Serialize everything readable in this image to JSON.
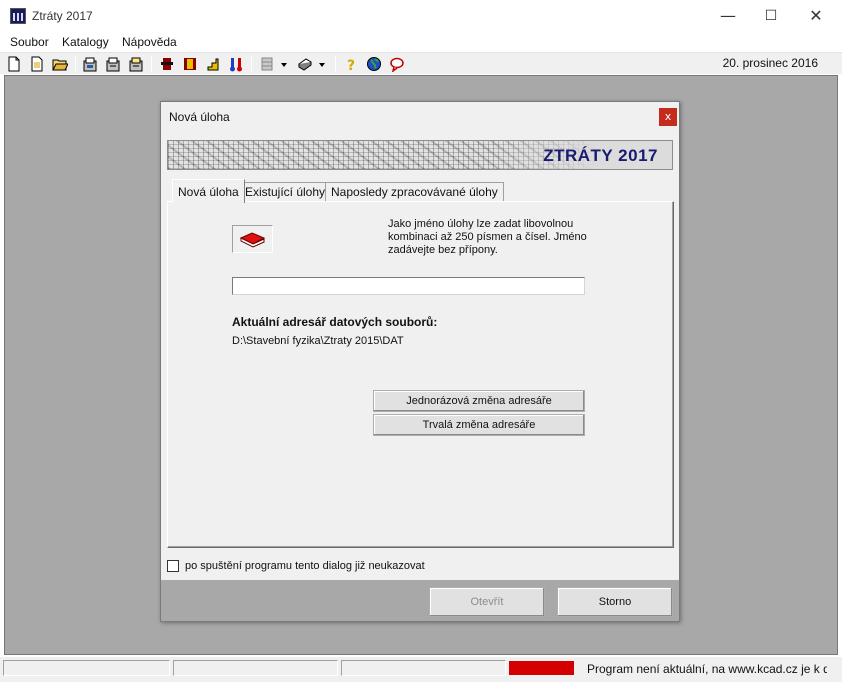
{
  "window": {
    "title": "Ztráty 2017",
    "controls": {
      "minimize": "—",
      "maximize": "☐",
      "close": "✕"
    }
  },
  "menu": {
    "items": [
      "Soubor",
      "Katalogy",
      "Nápověda"
    ]
  },
  "toolbar": {
    "icons": [
      "new-icon",
      "open-icon",
      "open-folder-icon",
      "catalog-icon",
      "catalog-edit-icon",
      "catalog-export-icon",
      "wall-icon",
      "window-icon",
      "stairs-icon",
      "thermometer-icon",
      "layers-icon",
      "print-icon",
      "help-icon",
      "globe-icon",
      "chat-icon"
    ],
    "date": "20. prosinec 2016"
  },
  "dialog": {
    "title": "Nová úloha",
    "close_label": "x",
    "banner_text": "ZTRÁTY 2017",
    "tabs": [
      {
        "label": "Nová úloha",
        "active": true
      },
      {
        "label": "Existující úlohy",
        "active": false
      },
      {
        "label": "Naposledy zpracovávané úlohy",
        "active": false
      }
    ],
    "help_text": "Jako jméno úlohy lze zadat libovolnou kombinaci až 250 písmen a čísel. Jméno zadávejte bez přípony.",
    "task_name_value": "",
    "dir_heading": "Aktuální adresář datových souborů:",
    "dir_path": "D:\\Stavební fyzika\\Ztraty 2015\\DAT",
    "btn_change_once": "Jednorázová změna adresáře",
    "btn_change_permanent": "Trvalá změna adresáře",
    "checkbox_label": "po spuštění programu tento dialog již neukazovat",
    "checkbox_checked": false,
    "btn_open": "Otevřít",
    "btn_cancel": "Storno"
  },
  "statusbar": {
    "indicator_color": "#d40000",
    "message": "Program není aktuální, na www.kcad.cz je k dispc"
  },
  "colors": {
    "workspace": "#a8a8a8",
    "banner_text": "#1a1a70",
    "close": "#c42b1c"
  }
}
